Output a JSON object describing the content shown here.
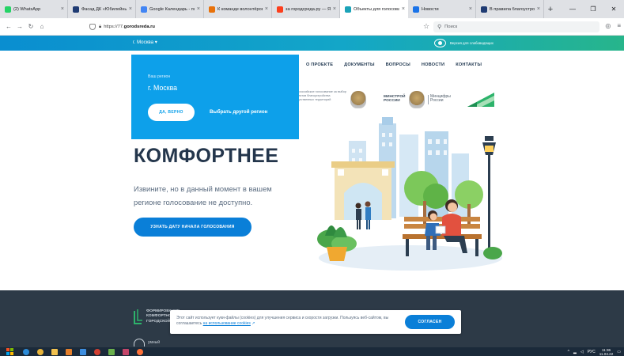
{
  "browser": {
    "tabs": [
      {
        "title": "(2) WhatsApp",
        "fav_color": "#25d366",
        "width": 86
      },
      {
        "title": "Фасад ДК «Юбилейный» с",
        "fav_color": "#1f3b73",
        "width": 86
      },
      {
        "title": "Google Календарь - понед",
        "fav_color": "#4285f4",
        "width": 86
      },
      {
        "title": "К команде волонтёров куд",
        "fav_color": "#e8710a",
        "width": 86
      },
      {
        "title": "за городсреда.ру — Яндекс",
        "fav_color": "#fc3f1d",
        "width": 86
      },
      {
        "title": "Объекты для голосования",
        "fav_color": "#1ba3b8",
        "width": 86,
        "active": true
      },
      {
        "title": "Новости",
        "fav_color": "#1a73e8",
        "width": 86
      },
      {
        "title": "В правила благоустройства",
        "fav_color": "#1f3b73",
        "width": 86
      }
    ],
    "new_tab_symbol": "+",
    "url_prefix": "https://77.",
    "url_domain": "gorodsreda.ru",
    "search_placeholder": "Поиск"
  },
  "header": {
    "region_link": "г. Москва ▾",
    "low_vision": "Версия для слабовидящих",
    "nav": [
      "О ПРОЕКТЕ",
      "ДОКУМЕНТЫ",
      "ВОПРОСЫ",
      "НОВОСТИ",
      "КОНТАКТЫ"
    ]
  },
  "partners": {
    "caption": "Всероссийское голосование за выбор объектов благоустройства общественных территорий",
    "minstroy": "МИНСТРОЙ РОССИИ",
    "mincifry": "Минцифры России"
  },
  "region_popup": {
    "lead": "Ваш регион",
    "city": "г. Москва",
    "yes_button": "ДА, ВЕРНО",
    "other_button": "Выбрать другой регион"
  },
  "hero": {
    "title": "КОМФОРТНЕЕ",
    "text": "Извините, но в данный момент в вашем регионе голосование не доступно.",
    "cta": "УЗНАТЬ ДАТУ НАЧАЛА ГОЛОСОВАНИЯ"
  },
  "footer": {
    "logo_text_1": "ФОРМИРОВАНИЕ",
    "logo_text_2": "КОМФОРТНОЙ",
    "logo_text_3": "ГОРОДСКОЙ",
    "logo2_text": "умный"
  },
  "cookie": {
    "text_before": "Этот сайт использует куки-файлы (cookies) для улучшения сервиса и скорости загрузки. Пользуясь веб-сайтом, вы соглашаетесь ",
    "link_text": "на использование cookies",
    "agree_button": "СОГЛАСЕН"
  },
  "taskbar": {
    "lang": "РУС",
    "time": "11:36",
    "date": "11.04.22"
  },
  "colors": {
    "accent_blue": "#0a7fd8",
    "popup_blue": "#0da0ea",
    "title_dark": "#24364c",
    "footer_dark": "#2d3a47"
  }
}
